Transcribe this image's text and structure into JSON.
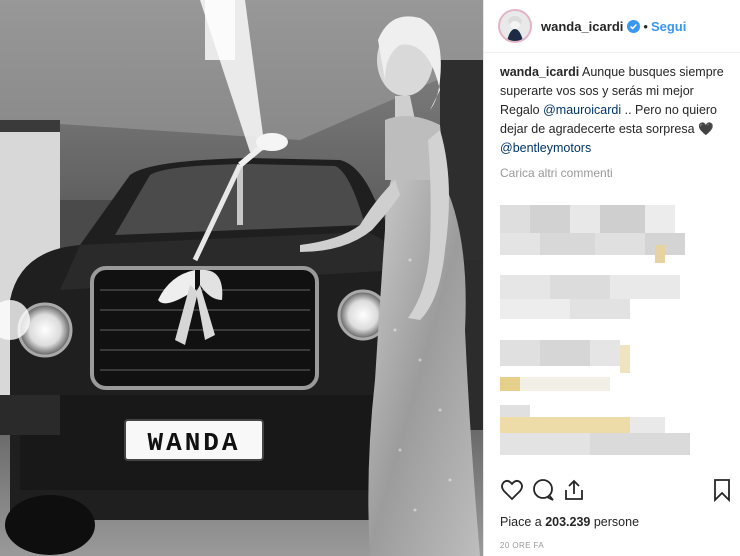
{
  "post": {
    "plate_text": "WANDA"
  },
  "header": {
    "username": "wanda_icardi",
    "dot": "•",
    "follow_label": "Segui"
  },
  "caption": {
    "username": "wanda_icardi",
    "text_part1": "Aunque busques siempre superarte vos sos y serás mi mejor Regalo",
    "mention1": "@mauroicardi",
    "text_part2": ".. Pero no quiero dejar de agradecerte esta sorpresa",
    "heart": "🖤",
    "mention2": "@bentleymotors"
  },
  "load_more_label": "Carica altri commenti",
  "likes": {
    "prefix": "Piace a",
    "count": "203.239",
    "suffix": "persone"
  },
  "timestamp": "20 ORE FA",
  "colors": {
    "link_blue": "#3897f0",
    "mention_blue": "#003569",
    "text": "#262626",
    "muted": "#999999"
  },
  "icons": [
    "verified-badge-icon",
    "heart-icon",
    "comment-icon",
    "share-icon",
    "bookmark-icon"
  ]
}
